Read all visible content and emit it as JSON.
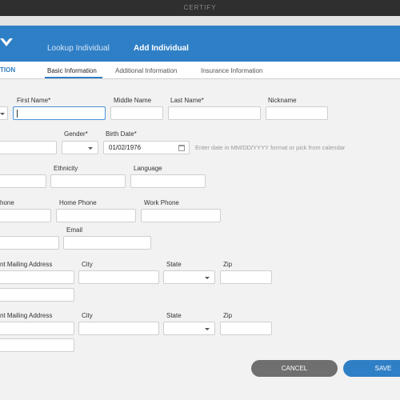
{
  "window": {
    "title": "CERTIFY"
  },
  "header": {
    "tabs": [
      {
        "label": "Lookup Individual"
      },
      {
        "label": "Add Individual"
      }
    ]
  },
  "subnav": {
    "section_label": "TION",
    "tabs": [
      {
        "label": "Basic Information"
      },
      {
        "label": "Additional Information"
      },
      {
        "label": "Insurance Information"
      }
    ]
  },
  "form": {
    "first_name_label": "First Name*",
    "middle_name_label": "Middle Name",
    "last_name_label": "Last Name*",
    "nickname_label": "Nickname",
    "gender_label": "Gender*",
    "birth_date_label": "Birth Date*",
    "birth_date_value": "01/02/1976",
    "birth_date_hint": "Enter date in MM/DD/YYYY format or pick from calendar",
    "ethnicity_label": "Ethnicity",
    "language_label": "Language",
    "cell_phone_label": "hone",
    "home_phone_label": "Home Phone",
    "work_phone_label": "Work Phone",
    "email_label": "Email",
    "address1_label": "nt Mailing Address",
    "city1_label": "City",
    "state1_label": "State",
    "zip1_label": "Zip",
    "address2_label": "nt Mailing Address",
    "city2_label": "City",
    "state2_label": "State",
    "zip2_label": "Zip"
  },
  "actions": {
    "cancel_label": "CANCEL",
    "save_label": "SAVE"
  },
  "colors": {
    "accent": "#2f7fc6",
    "cancel": "#6f6f6f",
    "focus": "#4a90d9"
  }
}
